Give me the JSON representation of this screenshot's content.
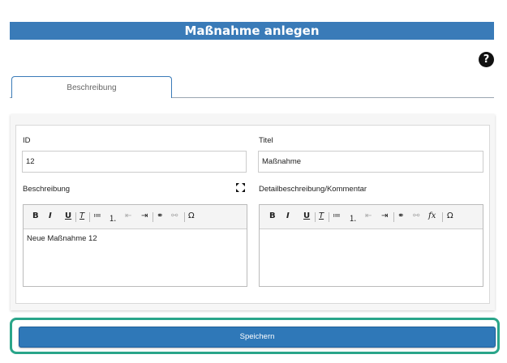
{
  "header": {
    "title": "Maßnahme anlegen"
  },
  "help": {
    "glyph": "?"
  },
  "tabs": [
    {
      "label": "Beschreibung"
    }
  ],
  "form": {
    "id_label": "ID",
    "id_value": "12",
    "title_label": "Titel",
    "title_value": "Maßnahme",
    "desc_label": "Beschreibung",
    "desc_text": "Neue Maßnahme 12",
    "detail_label": "Detailbeschreibung/Kommentar",
    "detail_text": ""
  },
  "toolbar": {
    "bold": "B",
    "italic": "I",
    "underline": "U",
    "clear_format": "T",
    "bullet_list": "≔",
    "numbered_list": "⒈",
    "outdent": "⇤",
    "indent": "⇥",
    "link": "⚭",
    "unlink": "⚯",
    "formula": "fx",
    "special_char": "Ω"
  },
  "actions": {
    "save_label": "Speichern"
  },
  "colors": {
    "header": "#3a7bb8",
    "save_button": "#2f78b8",
    "highlight": "#2aa58a"
  }
}
